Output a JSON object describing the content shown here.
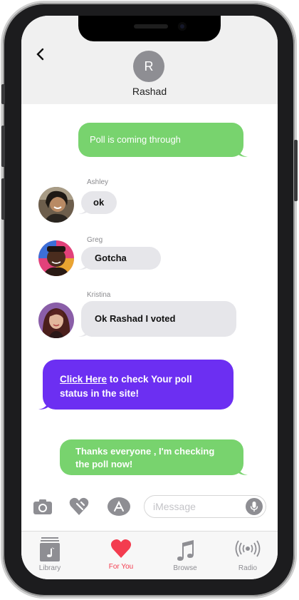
{
  "contact": {
    "initial": "R",
    "name": "Rashad"
  },
  "messages": [
    {
      "sender": "",
      "text": "Poll is coming through"
    },
    {
      "sender": "Ashley",
      "text": "ok"
    },
    {
      "sender": "Greg",
      "text": "Gotcha"
    },
    {
      "sender": "Kristina",
      "text": "Ok Rashad I voted"
    },
    {
      "link_text": "Click Here",
      "text_after": " to check Your poll status in the site!"
    },
    {
      "sender": "",
      "text": "Thanks everyone , I'm checking the poll now!"
    }
  ],
  "compose": {
    "placeholder": "iMessage"
  },
  "tabs": [
    {
      "label": "Library",
      "icon": "library-icon"
    },
    {
      "label": "For You",
      "icon": "heart-icon",
      "active": true
    },
    {
      "label": "Browse",
      "icon": "music-note-icon"
    },
    {
      "label": "Radio",
      "icon": "radio-icon"
    }
  ],
  "colors": {
    "sent": "#78d36e",
    "received": "#e6e6ea",
    "promo": "#6c2ff2",
    "active_tab": "#f33c4f"
  }
}
